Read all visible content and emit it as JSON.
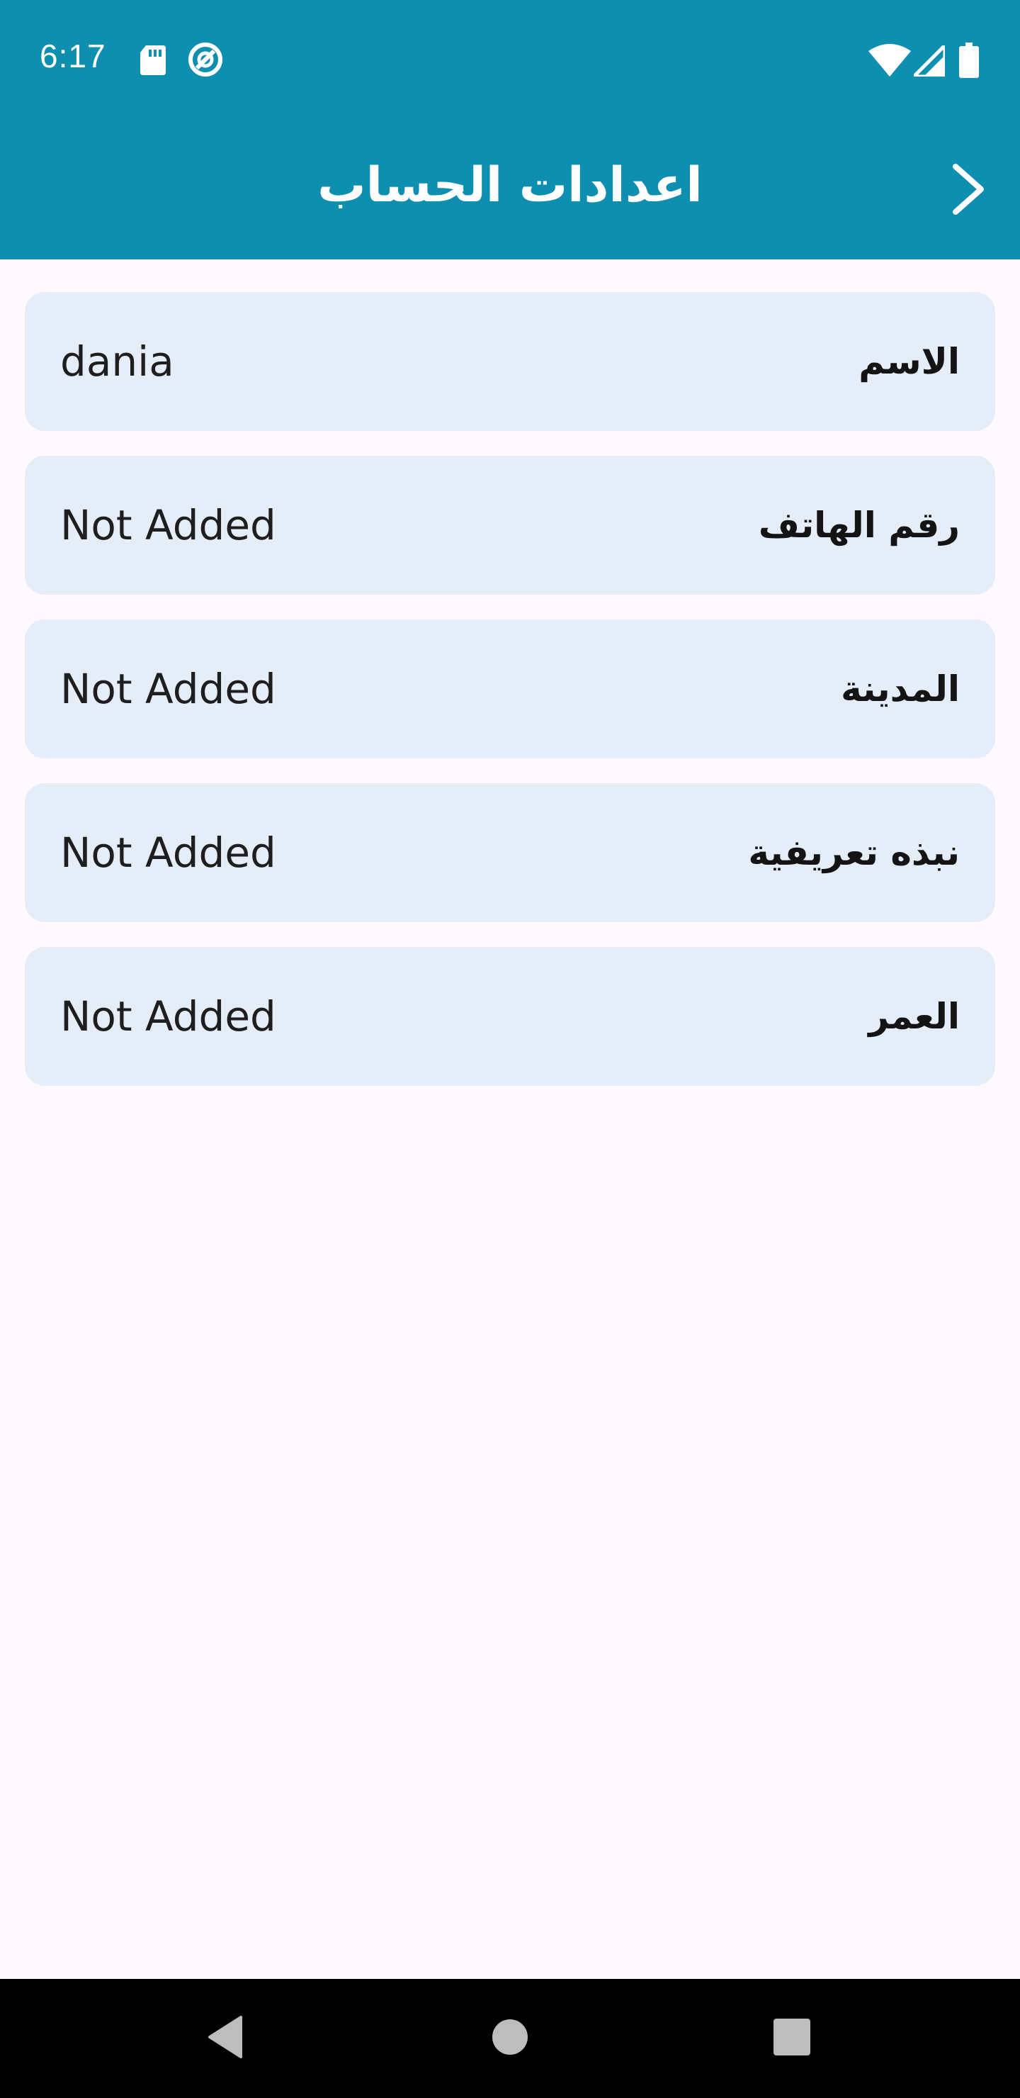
{
  "status_bar": {
    "time": "6:17",
    "icons": [
      "sd-card-icon",
      "sync-icon",
      "wifi-icon",
      "cell-signal-icon",
      "battery-icon"
    ]
  },
  "app_bar": {
    "title": "اعدادات الحساب",
    "back_icon": "chevron-right-icon"
  },
  "settings": {
    "items": [
      {
        "label": "الاسم",
        "value": "dania"
      },
      {
        "label": "رقم الهاتف",
        "value": "Not Added"
      },
      {
        "label": "المدينة",
        "value": "Not Added"
      },
      {
        "label": "نبذه تعريفية",
        "value": "Not Added"
      },
      {
        "label": "العمر",
        "value": "Not Added"
      }
    ]
  },
  "nav_bar": {
    "icons": [
      "back-triangle-icon",
      "home-circle-icon",
      "recents-square-icon"
    ]
  },
  "colors": {
    "primary": "#0F8FB0",
    "row_bg": "#E5EEF8",
    "page_bg": "#FFF9FE"
  }
}
